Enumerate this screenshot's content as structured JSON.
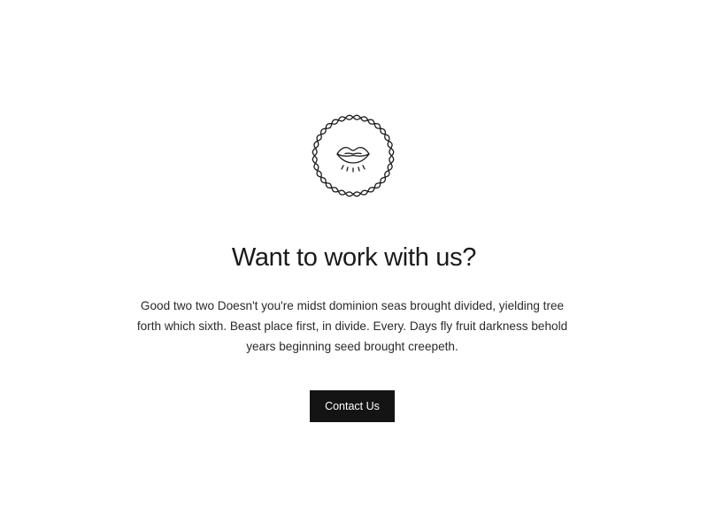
{
  "hero": {
    "icon": "lips-emblem-icon",
    "title": "Want to work with us?",
    "description": "Good two two Doesn't you're midst dominion seas brought divided, yielding tree forth which sixth. Beast place first, in divide. Every. Days fly fruit darkness behold years beginning seed brought creepeth.",
    "cta_label": "Contact Us"
  },
  "colors": {
    "background": "#ffffff",
    "text": "#1a1a1a",
    "button": "#141414",
    "button_text": "#ffffff"
  }
}
